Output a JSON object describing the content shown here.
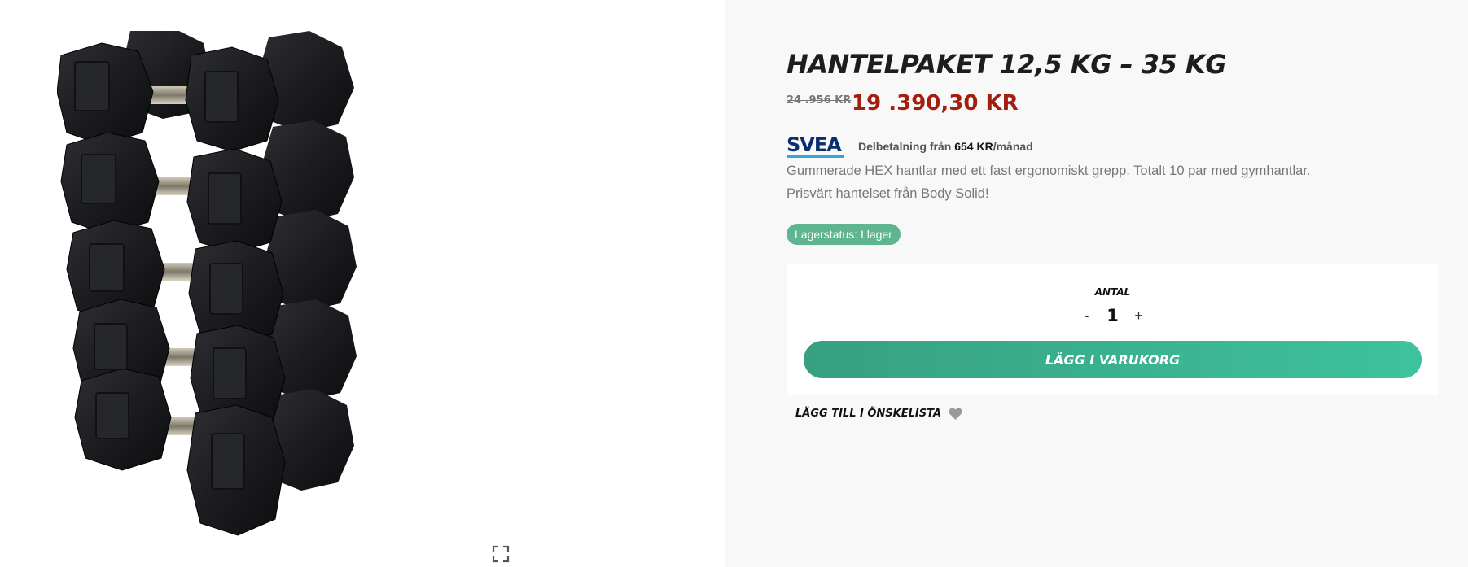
{
  "product": {
    "title": "HANTELPAKET 12,5 KG – 35 KG",
    "old_price": "24 .956 KR",
    "price": "19 .390,30 KR",
    "image_alt": "Gummerade HEX hantlar i ställ",
    "description": [
      "Gummerade HEX hantlar med ett fast ergonomiskt grepp. Totalt 10 par med gymhantlar.",
      "Prisvärt hantelset från Body Solid!"
    ],
    "stock_label": "Lagerstatus: I lager"
  },
  "financing": {
    "logo_text": "SVEA",
    "text": "Delbetalning från ",
    "amount": "654 KR",
    "period": "/månad"
  },
  "cart": {
    "quantity_label": "ANTAL",
    "decrement": "-",
    "quantity": "1",
    "increment": "+",
    "add_to_cart": "LÄGG I VARUKORG"
  },
  "wishlist": {
    "label": "LÄGG TILL I ÖNSKELISTA",
    "icon": "heart-icon"
  },
  "gallery": {
    "expand_icon": "expand-icon"
  },
  "colors": {
    "price": "#a21e0f",
    "accent": "#3ec29d",
    "stock_badge": "#5eb590",
    "svea_blue": "#0a2e6e"
  }
}
